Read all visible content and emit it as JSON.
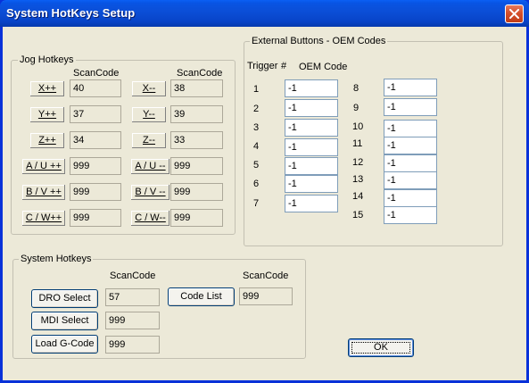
{
  "window": {
    "title": "System HotKeys Setup"
  },
  "jog": {
    "group_label": "Jog Hotkeys",
    "scancode_header_left": "ScanCode",
    "scancode_header_right": "ScanCode",
    "rows": [
      {
        "plus_label": "X++",
        "plus_code": "40",
        "minus_label": "X--",
        "minus_code": "38"
      },
      {
        "plus_label": "Y++",
        "plus_code": "37",
        "minus_label": "Y--",
        "minus_code": "39"
      },
      {
        "plus_label": "Z++",
        "plus_code": "34",
        "minus_label": "Z--",
        "minus_code": "33"
      },
      {
        "plus_label": "A / U ++",
        "plus_code": "999",
        "minus_label": "A / U --",
        "minus_code": "999"
      },
      {
        "plus_label": "B / V ++",
        "plus_code": "999",
        "minus_label": "B / V --",
        "minus_code": "999"
      },
      {
        "plus_label": "C / W++",
        "plus_code": "999",
        "minus_label": "C / W--",
        "minus_code": "999"
      }
    ]
  },
  "external": {
    "group_label": "External Buttons - OEM Codes",
    "trigger_header": "Trigger",
    "number_header": "#",
    "oem_header": "OEM Code",
    "left": [
      {
        "num": "1",
        "code": "-1"
      },
      {
        "num": "2",
        "code": "-1"
      },
      {
        "num": "3",
        "code": "-1"
      },
      {
        "num": "4",
        "code": "-1"
      },
      {
        "num": "5",
        "code": "-1"
      },
      {
        "num": "6",
        "code": "-1"
      },
      {
        "num": "7",
        "code": "-1"
      }
    ],
    "right": [
      {
        "num": "8",
        "code": "-1"
      },
      {
        "num": "9",
        "code": "-1"
      },
      {
        "num": "10",
        "code": "-1"
      },
      {
        "num": "11",
        "code": "-1"
      },
      {
        "num": "12",
        "code": "-1"
      },
      {
        "num": "13",
        "code": "-1"
      },
      {
        "num": "14",
        "code": "-1"
      },
      {
        "num": "15",
        "code": "-1"
      }
    ]
  },
  "system": {
    "group_label": "System Hotkeys",
    "scancode_header_left": "ScanCode",
    "scancode_header_right": "ScanCode",
    "dro_select": {
      "label": "DRO Select",
      "code": "57"
    },
    "mdi_select": {
      "label": "MDI Select",
      "code": "999"
    },
    "load_gcode": {
      "label": "Load G-Code",
      "code": "999"
    },
    "code_list": {
      "label": "Code List",
      "code": "999"
    }
  },
  "ok_button": {
    "label": "OK"
  },
  "icons": {
    "close": "close-icon"
  }
}
